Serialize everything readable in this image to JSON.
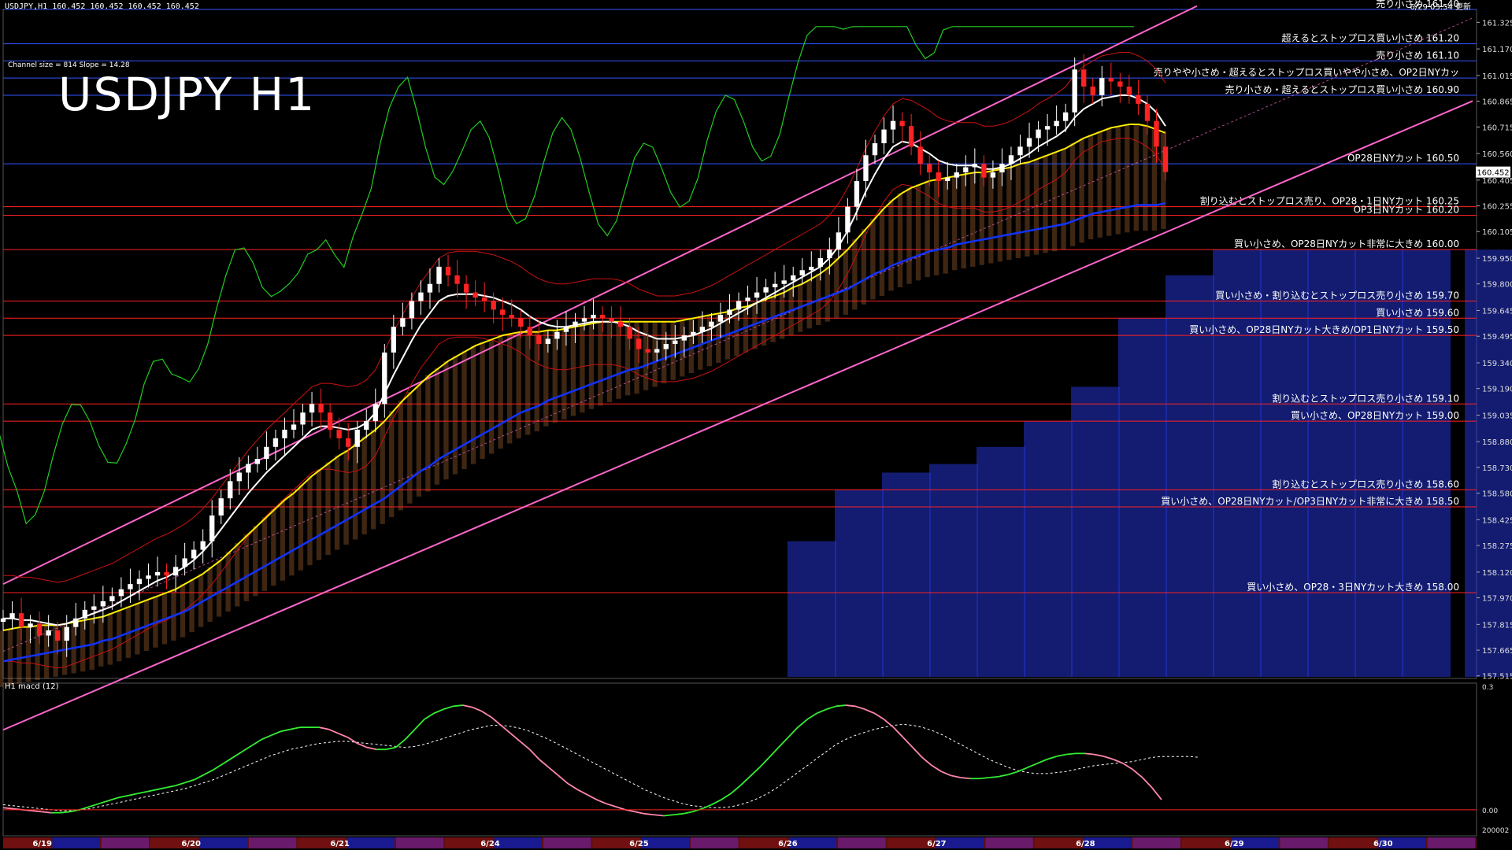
{
  "window": {
    "header": "USDJPY,H1  160.452 160.452 160.452 160.452",
    "channel_info": "Channel size = 814 Slope = 14.28",
    "big_title": "USDJPY H1",
    "top_right": "6/29 03:54 更新",
    "macd_label": "H1  macd (12)"
  },
  "colors": {
    "background": "#000000",
    "channel": "#ff66cc",
    "ma_white": "#ffffff",
    "ma_yellow": "#ffee00",
    "ma_blue": "#1133ff",
    "bollinger": "#cc1111",
    "chikou": "#22cc22",
    "cloud_blue": "#2233cc",
    "cloud_orange": "#dd8844",
    "candle_up": "#ffffff",
    "candle_down": "#ff2222",
    "level_red": "#ff2020",
    "level_blue": "#3355ff",
    "macd_green": "#33ee33",
    "macd_pink": "#ff88aa"
  },
  "chart_data": {
    "type": "candlestick",
    "symbol": "USDJPY",
    "timeframe": "H1",
    "ylim": [
      157.5,
      161.4
    ],
    "price_ticks": [
      "161.325",
      "161.170",
      "161.015",
      "160.865",
      "160.715",
      "160.560",
      "160.405",
      "160.255",
      "160.105",
      "159.950",
      "159.800",
      "159.645",
      "159.495",
      "159.340",
      "159.190",
      "159.035",
      "158.880",
      "158.730",
      "158.580",
      "158.425",
      "158.275",
      "158.120",
      "157.970",
      "157.815",
      "157.665",
      "157.515"
    ],
    "current_price": "160.452",
    "date_labels": [
      "6/19",
      "6/20",
      "6/21",
      "6/24",
      "6/25",
      "6/26",
      "6/27",
      "6/28",
      "6/29",
      "6/30"
    ],
    "date_positions": [
      0.02,
      0.121,
      0.222,
      0.324,
      0.425,
      0.526,
      0.627,
      0.728,
      0.829,
      0.93
    ],
    "levels": [
      {
        "price": 161.4,
        "label": "売り小さめ 161.40",
        "color": "#3355ff"
      },
      {
        "price": 161.2,
        "label": "超えるとストップロス買い小さめ 161.20",
        "color": "#3355ff"
      },
      {
        "price": 161.1,
        "label": "売り小さめ 161.10",
        "color": "#3355ff"
      },
      {
        "price": 161.0,
        "label": "売りやや小さめ・超えるとストップロス買いやや小さめ、OP2日NYカッ",
        "color": "#3355ff"
      },
      {
        "price": 160.9,
        "label": "売り小さめ・超えるとストップロス買い小さめ 160.90",
        "color": "#3355ff"
      },
      {
        "price": 160.5,
        "label": "OP28日NYカット 160.50",
        "color": "#3355ff"
      },
      {
        "price": 160.25,
        "label": "割り込むとストップロス売り、OP28・1日NYカット 160.25",
        "color": "#ff2020"
      },
      {
        "price": 160.2,
        "label": "OP3日NYカット 160.20",
        "color": "#ff2020"
      },
      {
        "price": 160.0,
        "label": "買い小さめ、OP28日NYカット非常に大きめ 160.00",
        "color": "#ff2020"
      },
      {
        "price": 159.7,
        "label": "買い小さめ・割り込むとストップロス売り小さめ 159.70",
        "color": "#ff2020"
      },
      {
        "price": 159.6,
        "label": "買い小さめ 159.60",
        "color": "#ff2020"
      },
      {
        "price": 159.5,
        "label": "買い小さめ、OP28日NYカット大きめ/OP1日NYカット 159.50",
        "color": "#ff2020"
      },
      {
        "price": 159.1,
        "label": "割り込むとストップロス売り小さめ 159.10",
        "color": "#ff2020"
      },
      {
        "price": 159.0,
        "label": "買い小さめ、OP28日NYカット 159.00",
        "color": "#ff2020"
      },
      {
        "price": 158.6,
        "label": "割り込むとストップロス売り小さめ 158.60",
        "color": "#ff2020"
      },
      {
        "price": 158.5,
        "label": "買い小さめ、OP28日NYカット/OP3日NYカット非常に大きめ 158.50",
        "color": "#ff2020"
      },
      {
        "price": 158.0,
        "label": "買い小さめ、OP28・3日NYカット大きめ 158.00",
        "color": "#ff2020"
      }
    ],
    "close_series": [
      157.85,
      157.88,
      157.8,
      157.82,
      157.75,
      157.78,
      157.72,
      157.8,
      157.85,
      157.9,
      157.92,
      157.95,
      157.98,
      158.02,
      158.05,
      158.08,
      158.1,
      158.12,
      158.1,
      158.15,
      158.2,
      158.25,
      158.3,
      158.45,
      158.55,
      158.65,
      158.7,
      158.75,
      158.78,
      158.85,
      158.9,
      158.95,
      158.98,
      159.05,
      159.1,
      159.05,
      158.95,
      158.9,
      158.85,
      158.95,
      159.0,
      159.1,
      159.4,
      159.55,
      159.6,
      159.7,
      159.75,
      159.8,
      159.9,
      159.85,
      159.8,
      159.75,
      159.72,
      159.7,
      159.65,
      159.62,
      159.6,
      159.55,
      159.5,
      159.45,
      159.48,
      159.52,
      159.55,
      159.58,
      159.6,
      159.62,
      159.6,
      159.58,
      159.55,
      159.48,
      159.42,
      159.4,
      159.42,
      159.45,
      159.47,
      159.5,
      159.52,
      159.55,
      159.58,
      159.62,
      159.65,
      159.7,
      159.72,
      159.75,
      159.78,
      159.8,
      159.82,
      159.85,
      159.88,
      159.9,
      159.95,
      160.0,
      160.1,
      160.25,
      160.4,
      160.55,
      160.62,
      160.7,
      160.75,
      160.72,
      160.6,
      160.5,
      160.45,
      160.4,
      160.42,
      160.45,
      160.48,
      160.5,
      160.42,
      160.45,
      160.5,
      160.55,
      160.6,
      160.65,
      160.7,
      160.72,
      160.75,
      160.8,
      161.05,
      160.95,
      160.9,
      161.0,
      160.98,
      160.95,
      160.9,
      160.85,
      160.75,
      160.6,
      160.452
    ],
    "ma_white": [
      157.85,
      157.85,
      157.84,
      157.84,
      157.83,
      157.82,
      157.81,
      157.82,
      157.84,
      157.86,
      157.88,
      157.9,
      157.92,
      157.95,
      157.98,
      158.01,
      158.04,
      158.07,
      158.09,
      158.12,
      158.15,
      158.19,
      158.24,
      158.3,
      158.37,
      158.44,
      158.51,
      158.58,
      158.64,
      158.7,
      158.75,
      158.8,
      158.85,
      158.9,
      158.95,
      158.97,
      158.97,
      158.96,
      158.95,
      158.96,
      158.99,
      159.05,
      159.16,
      159.27,
      159.37,
      159.47,
      159.56,
      159.63,
      159.7,
      159.73,
      159.74,
      159.74,
      159.74,
      159.73,
      159.72,
      159.7,
      159.68,
      159.65,
      159.61,
      159.58,
      159.56,
      159.55,
      159.55,
      159.56,
      159.57,
      159.58,
      159.58,
      159.58,
      159.57,
      159.55,
      159.52,
      159.5,
      159.48,
      159.48,
      159.48,
      159.49,
      159.5,
      159.52,
      159.54,
      159.57,
      159.6,
      159.63,
      159.66,
      159.69,
      159.72,
      159.75,
      159.78,
      159.81,
      159.84,
      159.87,
      159.9,
      159.95,
      160.02,
      160.11,
      160.22,
      160.34,
      160.44,
      160.53,
      160.6,
      160.63,
      160.62,
      160.59,
      160.56,
      160.52,
      160.5,
      160.49,
      160.49,
      160.49,
      160.47,
      160.47,
      160.48,
      160.5,
      160.53,
      160.56,
      160.6,
      160.63,
      160.66,
      160.7,
      160.77,
      160.82,
      160.85,
      160.88,
      160.89,
      160.9,
      160.9,
      160.88,
      160.85,
      160.8,
      160.72
    ],
    "ma_yellow": [
      157.78,
      157.79,
      157.8,
      157.8,
      157.81,
      157.81,
      157.81,
      157.82,
      157.83,
      157.84,
      157.85,
      157.86,
      157.88,
      157.9,
      157.92,
      157.94,
      157.96,
      157.98,
      158.0,
      158.02,
      158.05,
      158.08,
      158.11,
      158.15,
      158.19,
      158.24,
      158.29,
      158.34,
      158.39,
      158.44,
      158.49,
      158.54,
      158.58,
      158.63,
      158.68,
      158.72,
      158.76,
      158.8,
      158.83,
      158.87,
      158.91,
      158.95,
      159.0,
      159.06,
      159.12,
      159.17,
      159.22,
      159.27,
      159.31,
      159.35,
      159.38,
      159.41,
      159.44,
      159.46,
      159.48,
      159.5,
      159.51,
      159.52,
      159.52,
      159.52,
      159.53,
      159.53,
      159.54,
      159.55,
      159.56,
      159.57,
      159.58,
      159.58,
      159.58,
      159.58,
      159.58,
      159.58,
      159.58,
      159.58,
      159.58,
      159.59,
      159.6,
      159.61,
      159.62,
      159.63,
      159.64,
      159.66,
      159.67,
      159.69,
      159.71,
      159.73,
      159.75,
      159.78,
      159.8,
      159.83,
      159.86,
      159.9,
      159.95,
      160.0,
      160.06,
      160.12,
      160.18,
      160.24,
      160.29,
      160.33,
      160.36,
      160.38,
      160.4,
      160.41,
      160.42,
      160.43,
      160.44,
      160.45,
      160.45,
      160.46,
      160.47,
      160.48,
      160.5,
      160.51,
      160.53,
      160.55,
      160.57,
      160.59,
      160.62,
      160.65,
      160.67,
      160.69,
      160.71,
      160.72,
      160.73,
      160.73,
      160.72,
      160.7,
      160.68
    ],
    "ma_blue": [
      157.6,
      157.61,
      157.62,
      157.63,
      157.64,
      157.65,
      157.66,
      157.67,
      157.68,
      157.69,
      157.7,
      157.72,
      157.73,
      157.75,
      157.77,
      157.79,
      157.81,
      157.83,
      157.85,
      157.87,
      157.89,
      157.92,
      157.95,
      157.98,
      158.01,
      158.04,
      158.07,
      158.1,
      158.13,
      158.16,
      158.19,
      158.22,
      158.25,
      158.28,
      158.31,
      158.34,
      158.37,
      158.4,
      158.43,
      158.46,
      158.49,
      158.52,
      158.55,
      158.59,
      158.63,
      158.67,
      158.71,
      158.74,
      158.78,
      158.81,
      158.84,
      158.87,
      158.9,
      158.93,
      158.96,
      158.99,
      159.02,
      159.05,
      159.07,
      159.09,
      159.12,
      159.14,
      159.16,
      159.18,
      159.2,
      159.22,
      159.24,
      159.26,
      159.28,
      159.3,
      159.31,
      159.33,
      159.35,
      159.37,
      159.39,
      159.41,
      159.43,
      159.45,
      159.47,
      159.49,
      159.51,
      159.53,
      159.55,
      159.57,
      159.59,
      159.61,
      159.63,
      159.65,
      159.67,
      159.69,
      159.71,
      159.73,
      159.75,
      159.77,
      159.8,
      159.83,
      159.86,
      159.88,
      159.91,
      159.93,
      159.95,
      159.97,
      159.99,
      160.0,
      160.01,
      160.03,
      160.04,
      160.05,
      160.06,
      160.07,
      160.08,
      160.09,
      160.1,
      160.11,
      160.12,
      160.13,
      160.14,
      160.15,
      160.17,
      160.19,
      160.21,
      160.22,
      160.23,
      160.24,
      160.25,
      160.26,
      160.26,
      160.26,
      160.27
    ],
    "macd_signal": [
      0.05,
      0.04,
      0.03,
      0.02,
      0.01,
      0.0,
      -0.01,
      -0.01,
      0.0,
      0.01,
      0.03,
      0.05,
      0.07,
      0.09,
      0.11,
      0.13,
      0.15,
      0.17,
      0.19,
      0.21,
      0.24,
      0.27,
      0.3,
      0.34,
      0.38,
      0.42,
      0.46,
      0.5,
      0.54,
      0.57,
      0.6,
      0.62,
      0.64,
      0.66,
      0.67,
      0.68,
      0.68,
      0.67,
      0.66,
      0.65,
      0.64,
      0.63,
      0.62,
      0.63,
      0.65,
      0.68,
      0.71,
      0.74,
      0.77,
      0.8,
      0.82,
      0.84,
      0.84,
      0.83,
      0.81,
      0.78,
      0.74,
      0.7,
      0.65,
      0.6,
      0.55,
      0.5,
      0.45,
      0.4,
      0.35,
      0.3,
      0.25,
      0.2,
      0.16,
      0.12,
      0.09,
      0.06,
      0.04,
      0.03,
      0.02,
      0.02,
      0.03,
      0.05,
      0.08,
      0.12,
      0.17,
      0.23,
      0.3,
      0.37,
      0.44,
      0.51,
      0.58,
      0.65,
      0.7,
      0.74,
      0.77,
      0.8,
      0.82,
      0.84,
      0.85,
      0.84,
      0.82,
      0.79,
      0.75,
      0.7,
      0.65,
      0.6,
      0.55,
      0.5,
      0.46,
      0.42,
      0.39,
      0.37,
      0.36,
      0.36,
      0.37,
      0.38,
      0.4,
      0.42,
      0.44,
      0.45,
      0.46,
      0.47,
      0.48,
      0.5,
      0.52,
      0.53,
      0.53,
      0.53,
      0.53,
      0.52
    ],
    "macd_main": [
      0.02,
      0.01,
      0.0,
      -0.01,
      -0.02,
      -0.03,
      -0.03,
      -0.02,
      0.0,
      0.03,
      0.06,
      0.09,
      0.12,
      0.14,
      0.16,
      0.18,
      0.2,
      0.22,
      0.24,
      0.27,
      0.3,
      0.35,
      0.4,
      0.46,
      0.52,
      0.58,
      0.64,
      0.7,
      0.74,
      0.78,
      0.8,
      0.82,
      0.82,
      0.82,
      0.8,
      0.76,
      0.72,
      0.66,
      0.62,
      0.6,
      0.6,
      0.62,
      0.7,
      0.8,
      0.9,
      0.96,
      1.0,
      1.03,
      1.04,
      1.02,
      0.98,
      0.92,
      0.84,
      0.76,
      0.68,
      0.6,
      0.5,
      0.42,
      0.34,
      0.26,
      0.2,
      0.15,
      0.1,
      0.06,
      0.03,
      0.0,
      -0.02,
      -0.04,
      -0.05,
      -0.06,
      -0.05,
      -0.04,
      -0.02,
      0.01,
      0.05,
      0.1,
      0.16,
      0.24,
      0.33,
      0.42,
      0.52,
      0.62,
      0.72,
      0.82,
      0.9,
      0.96,
      1.0,
      1.03,
      1.04,
      1.03,
      1.0,
      0.96,
      0.9,
      0.82,
      0.72,
      0.62,
      0.52,
      0.44,
      0.38,
      0.34,
      0.32,
      0.31,
      0.31,
      0.32,
      0.33,
      0.35,
      0.38,
      0.42,
      0.46,
      0.5,
      0.53,
      0.55,
      0.56,
      0.56,
      0.55,
      0.53,
      0.5,
      0.46,
      0.4,
      0.32,
      0.22,
      0.1
    ],
    "macd_ticks": [
      "0.3",
      "0.00",
      "200002"
    ]
  }
}
